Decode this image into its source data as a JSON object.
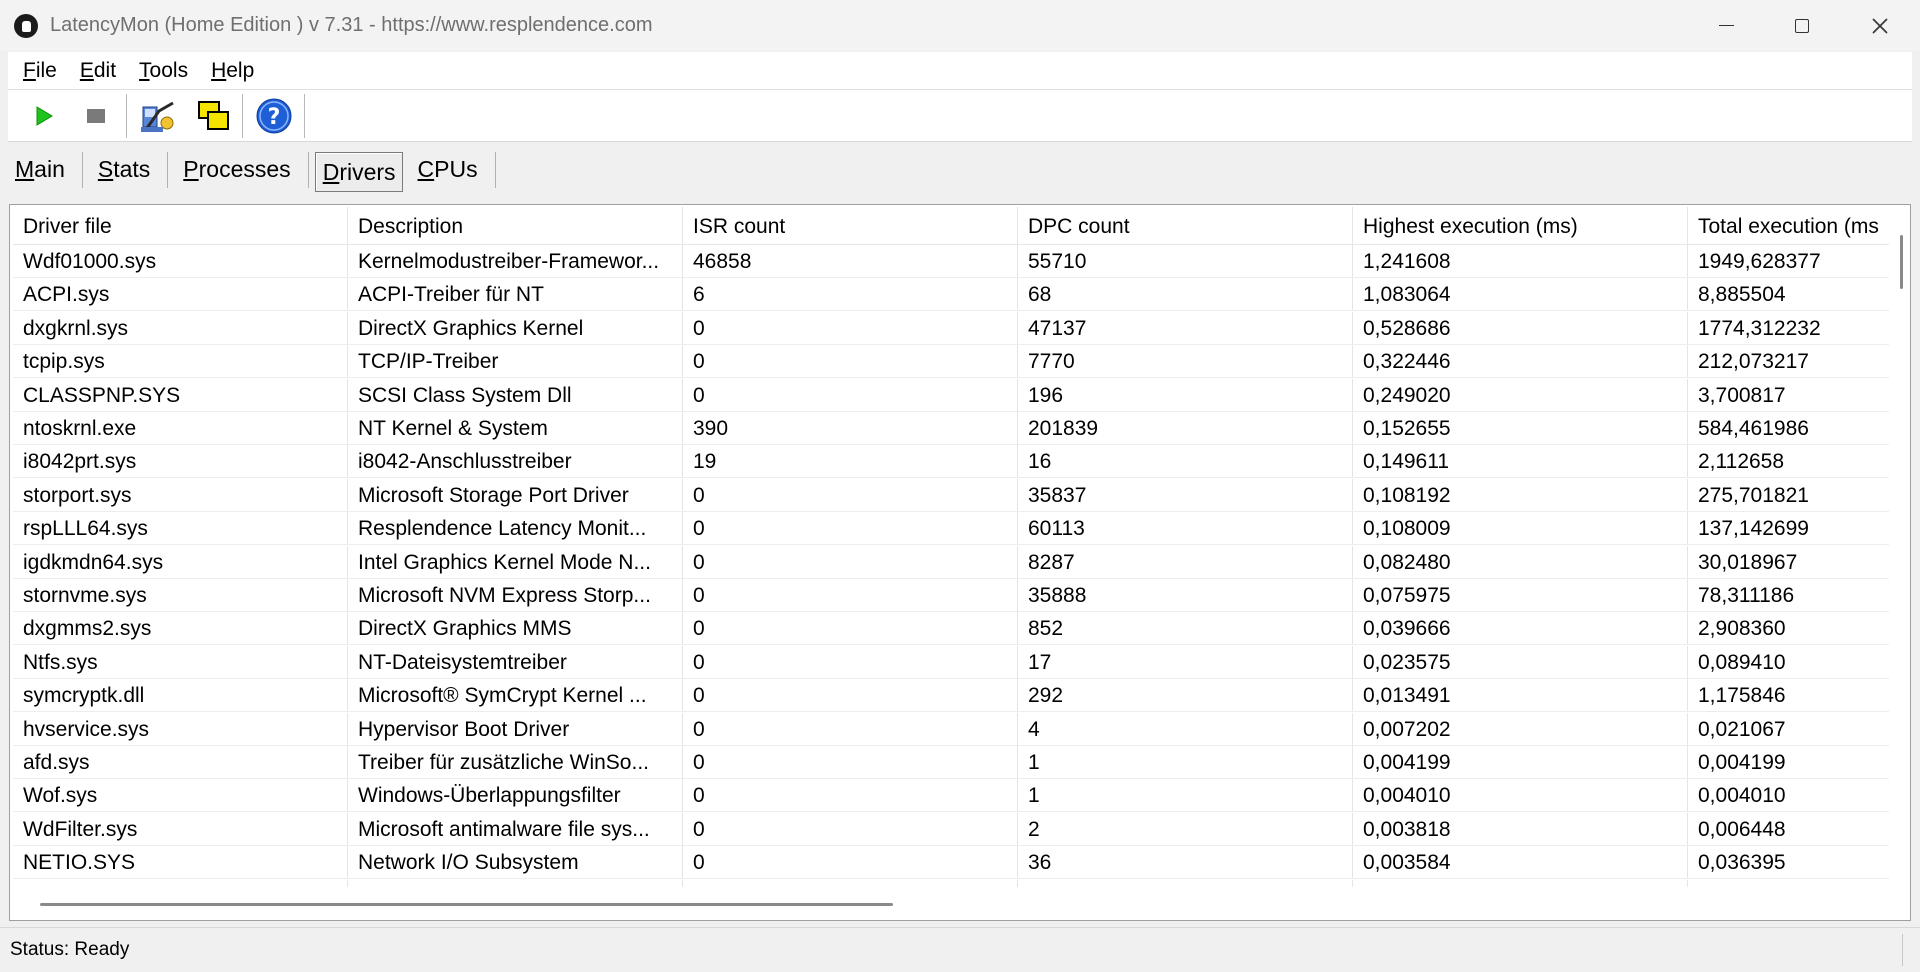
{
  "window": {
    "title": "LatencyMon  (Home Edition )  v 7.31 - https://www.resplendence.com"
  },
  "menu": [
    {
      "underline": "F",
      "rest": "ile"
    },
    {
      "underline": "E",
      "rest": "dit"
    },
    {
      "underline": "T",
      "rest": "ools"
    },
    {
      "underline": "H",
      "rest": "elp"
    }
  ],
  "toolbar": {
    "icons": [
      "play-icon",
      "stop-icon",
      "kernel-timer-icon",
      "windows-icon",
      "help-icon"
    ],
    "colors": {
      "play": "#1ec31e",
      "stop": "#7a7a7a",
      "help": "#1f5fd6"
    }
  },
  "tabs": [
    {
      "underline": "M",
      "rest": "ain",
      "active": false
    },
    {
      "underline": "S",
      "rest": "tats",
      "active": false
    },
    {
      "underline": "P",
      "rest": "rocesses",
      "active": false
    },
    {
      "underline": "D",
      "rest": "rivers",
      "active": true
    },
    {
      "underline": "C",
      "rest": "PUs",
      "active": false
    }
  ],
  "table": {
    "columns": [
      "Driver file",
      "Description",
      "ISR count",
      "DPC count",
      "Highest execution (ms)",
      "Total execution (ms"
    ],
    "rows": [
      [
        "Wdf01000.sys",
        "Kernelmodustreiber-Framewor...",
        "46858",
        "55710",
        "1,241608",
        "1949,628377"
      ],
      [
        "ACPI.sys",
        "ACPI-Treiber für NT",
        "6",
        "68",
        "1,083064",
        "8,885504"
      ],
      [
        "dxgkrnl.sys",
        "DirectX Graphics Kernel",
        "0",
        "47137",
        "0,528686",
        "1774,312232"
      ],
      [
        "tcpip.sys",
        "TCP/IP-Treiber",
        "0",
        "7770",
        "0,322446",
        "212,073217"
      ],
      [
        "CLASSPNP.SYS",
        "SCSI Class System Dll",
        "0",
        "196",
        "0,249020",
        "3,700817"
      ],
      [
        "ntoskrnl.exe",
        "NT Kernel & System",
        "390",
        "201839",
        "0,152655",
        "584,461986"
      ],
      [
        "i8042prt.sys",
        "i8042-Anschlusstreiber",
        "19",
        "16",
        "0,149611",
        "2,112658"
      ],
      [
        "storport.sys",
        "Microsoft Storage Port Driver",
        "0",
        "35837",
        "0,108192",
        "275,701821"
      ],
      [
        "rspLLL64.sys",
        "Resplendence Latency Monit...",
        "0",
        "60113",
        "0,108009",
        "137,142699"
      ],
      [
        "igdkmdn64.sys",
        "Intel Graphics Kernel Mode N...",
        "0",
        "8287",
        "0,082480",
        "30,018967"
      ],
      [
        "stornvme.sys",
        "Microsoft NVM Express Storp...",
        "0",
        "35888",
        "0,075975",
        "78,311186"
      ],
      [
        "dxgmms2.sys",
        "DirectX Graphics MMS",
        "0",
        "852",
        "0,039666",
        "2,908360"
      ],
      [
        "Ntfs.sys",
        "NT-Dateisystemtreiber",
        "0",
        "17",
        "0,023575",
        "0,089410"
      ],
      [
        "symcryptk.dll",
        "Microsoft® SymCrypt Kernel ...",
        "0",
        "292",
        "0,013491",
        "1,175846"
      ],
      [
        "hvservice.sys",
        "Hypervisor Boot Driver",
        "0",
        "4",
        "0,007202",
        "0,021067"
      ],
      [
        "afd.sys",
        "Treiber für zusätzliche WinSo...",
        "0",
        "1",
        "0,004199",
        "0,004199"
      ],
      [
        "Wof.sys",
        "Windows-Überlappungsfilter",
        "0",
        "1",
        "0,004010",
        "0,004010"
      ],
      [
        "WdFilter.sys",
        "Microsoft antimalware file sys...",
        "0",
        "2",
        "0,003818",
        "0,006448"
      ],
      [
        "NETIO.SYS",
        "Network I/O Subsystem",
        "0",
        "36",
        "0,003584",
        "0,036395"
      ]
    ]
  },
  "status": {
    "text": "Status: Ready"
  }
}
